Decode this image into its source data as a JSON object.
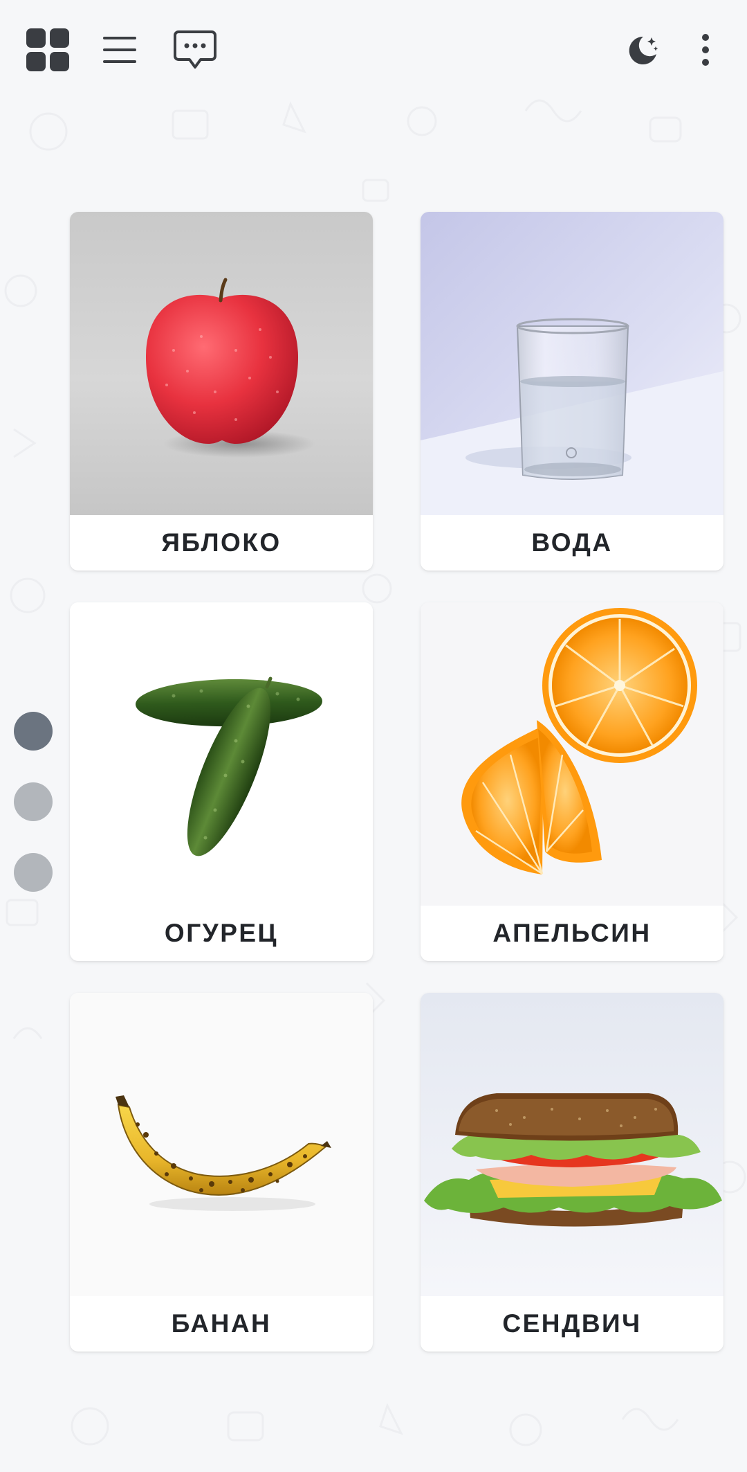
{
  "toolbar": {
    "icons": [
      "grid-icon",
      "hamburger-menu-icon",
      "chat-bubble-icon",
      "moon-stars-icon",
      "more-vertical-icon"
    ]
  },
  "pager": {
    "pages": 3,
    "active": 1
  },
  "cards": [
    {
      "label": "ЯБЛОКО",
      "image": "apple"
    },
    {
      "label": "ВОДА",
      "image": "glass-of-water"
    },
    {
      "label": "ОГУРЕЦ",
      "image": "cucumbers"
    },
    {
      "label": "АПЕЛЬСИН",
      "image": "orange"
    },
    {
      "label": "БАНАН",
      "image": "banana"
    },
    {
      "label": "СЕНДВИЧ",
      "image": "sandwich"
    }
  ],
  "colors": {
    "background": "#f6f7f9",
    "card": "#ffffff",
    "icon": "#3a3d42",
    "dot_active": "#6b7480",
    "dot_inactive": "#b2b6bb"
  }
}
